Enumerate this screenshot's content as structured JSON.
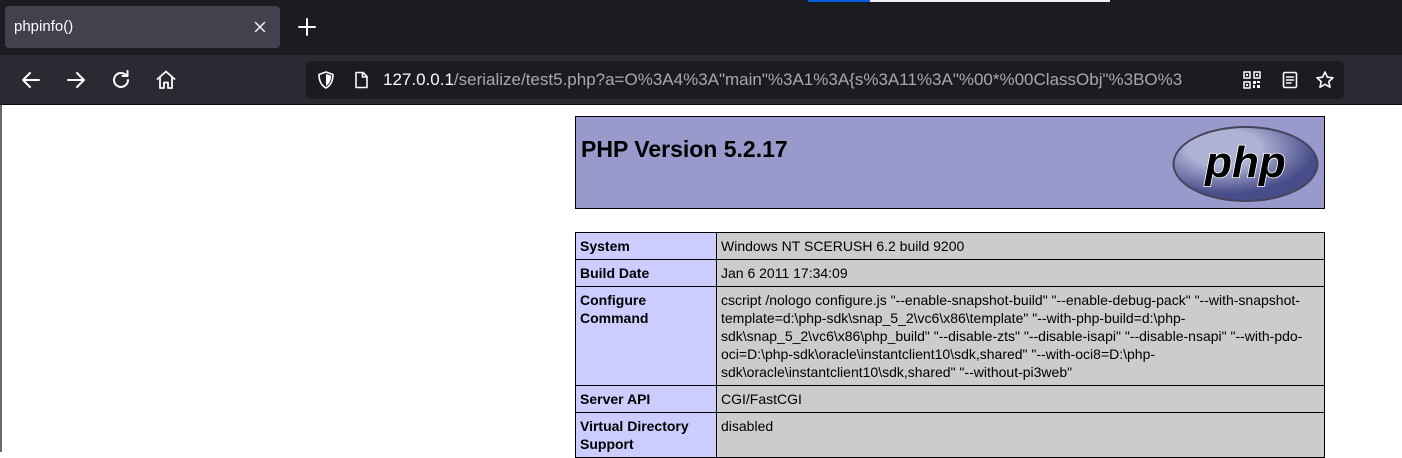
{
  "browser": {
    "tab": {
      "title": "phpinfo()"
    },
    "address_bar": {
      "host": "127.0.0.1",
      "path": "/serialize/test5.php?a=O%3A4%3A\"main\"%3A1%3A{s%3A11%3A\"%00*%00ClassObj\"%3BO%3"
    },
    "icons": {
      "close": "close-icon",
      "new_tab": "plus-icon",
      "back": "arrow-left-icon",
      "forward": "arrow-right-icon",
      "reload": "reload-icon",
      "home": "home-icon",
      "tracking_protection": "shield-icon",
      "page_info": "page-icon",
      "qr_code": "qr-code-icon",
      "reader_view": "reader-view-icon",
      "bookmark": "star-icon"
    },
    "colors": {
      "tabstrip_bg": "#1c1b22",
      "toolbar_bg": "#2b2a33",
      "selected_tab_bg": "#42414d",
      "url_field_bg": "#1c1b22"
    }
  },
  "page": {
    "header": {
      "title": "PHP Version 5.2.17",
      "logo_text": "php"
    },
    "info_rows": [
      {
        "key": "System",
        "value": "Windows NT SCERUSH 6.2 build 9200"
      },
      {
        "key": "Build Date",
        "value": "Jan 6 2011 17:34:09"
      },
      {
        "key": "Configure Command",
        "value": "cscript /nologo configure.js \"--enable-snapshot-build\" \"--enable-debug-pack\" \"--with-snapshot-template=d:\\php-sdk\\snap_5_2\\vc6\\x86\\template\" \"--with-php-build=d:\\php-sdk\\snap_5_2\\vc6\\x86\\php_build\" \"--disable-zts\" \"--disable-isapi\" \"--disable-nsapi\" \"--with-pdo-oci=D:\\php-sdk\\oracle\\instantclient10\\sdk,shared\" \"--with-oci8=D:\\php-sdk\\oracle\\instantclient10\\sdk,shared\" \"--without-pi3web\""
      },
      {
        "key": "Server API",
        "value": "CGI/FastCGI"
      },
      {
        "key": "Virtual Directory Support",
        "value": "disabled"
      }
    ],
    "colors": {
      "header_bg": "#9999cc",
      "key_cell_bg": "#ccccff",
      "value_cell_bg": "#cccccc"
    }
  }
}
